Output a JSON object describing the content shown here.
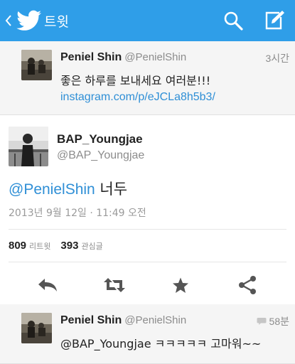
{
  "appbar": {
    "title": "트윗",
    "icons": [
      "back-chevron-icon",
      "twitter-bird-icon",
      "search-icon",
      "compose-icon"
    ],
    "color": "#2f9ee8"
  },
  "reply_top": {
    "name": "Peniel Shin",
    "handle": "@PenielShin",
    "time": "3시간",
    "text": "좋은 하루를 보내세요 여러분!!!",
    "link": "instagram.com/p/eJCLa8h5b3/"
  },
  "main_tweet": {
    "name": "BAP_Youngjae",
    "handle": "@BAP_Youngjae",
    "mention": "@PenielShin",
    "text": " 너두",
    "date": "2013년 9월 12일 · 11:49 오전",
    "retweets": "809",
    "retweets_label": "리트윗",
    "favorites": "393",
    "favorites_label": "관심글",
    "actions": [
      "reply-icon",
      "retweet-icon",
      "favorite-star-icon",
      "share-icon"
    ]
  },
  "reply_bottom": {
    "name": "Peniel Shin",
    "handle": "@PenielShin",
    "time": "58분",
    "text": "@BAP_Youngjae ㅋㅋㅋㅋㅋ 고마워~~"
  },
  "colors": {
    "link": "#2f8fd6",
    "secondary_text": "#8c8c8c",
    "icon_gray": "#555555"
  }
}
